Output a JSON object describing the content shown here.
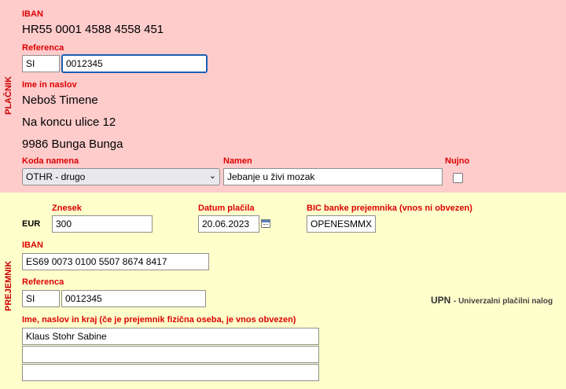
{
  "payer": {
    "side_label": "PLAČNIK",
    "iban_label": "IBAN",
    "iban_value": "HR55 0001 4588 4558 451",
    "reference_label": "Referenca",
    "reference_model": "SI",
    "reference_number": "0012345",
    "name_label": "Ime in naslov",
    "name_line1": "Neboš Timene",
    "name_line2": "Na koncu ulice 12",
    "name_line3": "9986 Bunga Bunga",
    "purpose_code_label": "Koda namena",
    "purpose_code_value": "OTHR - drugo",
    "purpose_label": "Namen",
    "purpose_value": "Jebanje u živi mozak",
    "urgent_label": "Nujno",
    "urgent_checked": false
  },
  "payee": {
    "side_label": "PREJEMNIK",
    "amount_label": "Znesek",
    "currency": "EUR",
    "amount_value": "300",
    "date_label": "Datum plačila",
    "date_value": "20.06.2023",
    "bic_label": "BIC banke prejemnika (vnos ni obvezen)",
    "bic_value": "OPENESMMXXX",
    "iban_label": "IBAN",
    "iban_value": "ES69 0073 0100 5507 8674 8417",
    "reference_label": "Referenca",
    "reference_model": "SI",
    "reference_number": "0012345",
    "upn_title": "UPN",
    "upn_subtitle": "- Univerzalni plačilni nalog",
    "name_label": "Ime, naslov in kraj (če je prejemnik fizična oseba, je vnos obvezen)",
    "name_line1": "Klaus Stohr Sabine",
    "name_line2": "",
    "name_line3": ""
  },
  "colors": {
    "payer_bg": "#ffcccc",
    "payee_bg": "#ffffcc",
    "label_red": "#dd0000",
    "focus_blue": "#1a5fb4"
  }
}
